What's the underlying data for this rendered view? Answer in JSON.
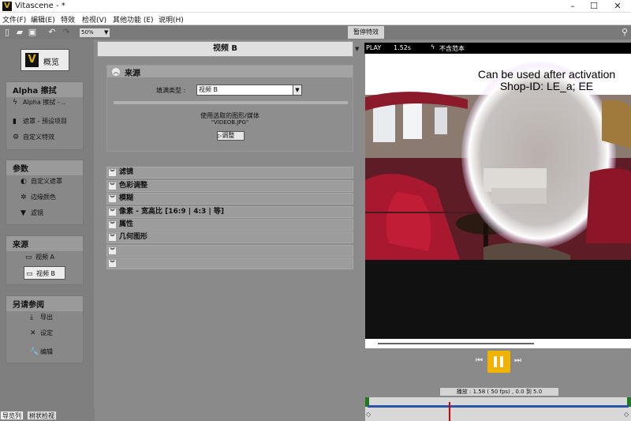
{
  "window": {
    "title": "Vitascene - *",
    "app_logo": "V"
  },
  "menu": [
    "文件(F)",
    "编辑(E)",
    "特效",
    "检视(V)",
    "其他功能 (E)",
    "说明(H)"
  ],
  "toolbar": {
    "zoom": "50%"
  },
  "preview_tab": "暂停特效",
  "overview": {
    "logo": "V",
    "label": "概览"
  },
  "groups": [
    {
      "title": "Alpha 擦拭",
      "items": [
        "Alpha 擦拭 - ..",
        "遮罩 - 预设项目",
        "自定义特效"
      ]
    },
    {
      "title": "参数",
      "items": [
        "自定义遮罩",
        "边缘颜色",
        "滤镜"
      ]
    },
    {
      "title": "来源",
      "items": [
        "视频 A",
        "视频 B"
      ]
    },
    {
      "title": "另请参阅",
      "items": [
        "导出",
        "设定",
        "编辑"
      ]
    }
  ],
  "bottom_tabs": [
    "导览列",
    "树状检视"
  ],
  "middle": {
    "header": "视频 B",
    "source_title": "来源",
    "fill_type_label": "填满类型 :",
    "fill_type_value": "视频 B",
    "media_line1": "使用选取的图形/媒体",
    "media_line2": "\"VIDEOB.JPG\"",
    "adjust_button": "调整"
  },
  "accordions": [
    "滤镜",
    "色彩调整",
    "模糊",
    "像素 - 宽高比 [16:9 | 4:3 | 等]",
    "属性",
    "几何图形",
    "",
    ""
  ],
  "viewer": {
    "mode": "PLAY",
    "time": "1.52s",
    "no_sample": "不含范本",
    "overlay_line1": "Can be used after activation",
    "overlay_line2": "Shop-ID:  LE_a; EE",
    "status": "播放 : 1.58 ( 50 fps) , 0.0 到 5.0"
  },
  "icons": [
    "file-new-icon",
    "folder-open-icon",
    "save-icon",
    "undo-icon",
    "redo-icon",
    "pin-icon",
    "lightning-icon",
    "mask-icon",
    "gear-icon",
    "palette-icon",
    "sparkle-icon",
    "filter-icon",
    "monitor-icon",
    "download-icon",
    "settings-icon",
    "wrench-icon",
    "chevron-up-icon",
    "chevron-down-icon",
    "skip-back-icon",
    "pause-icon",
    "skip-forward-icon"
  ],
  "timeline": {
    "playhead_fraction": 0.31
  }
}
